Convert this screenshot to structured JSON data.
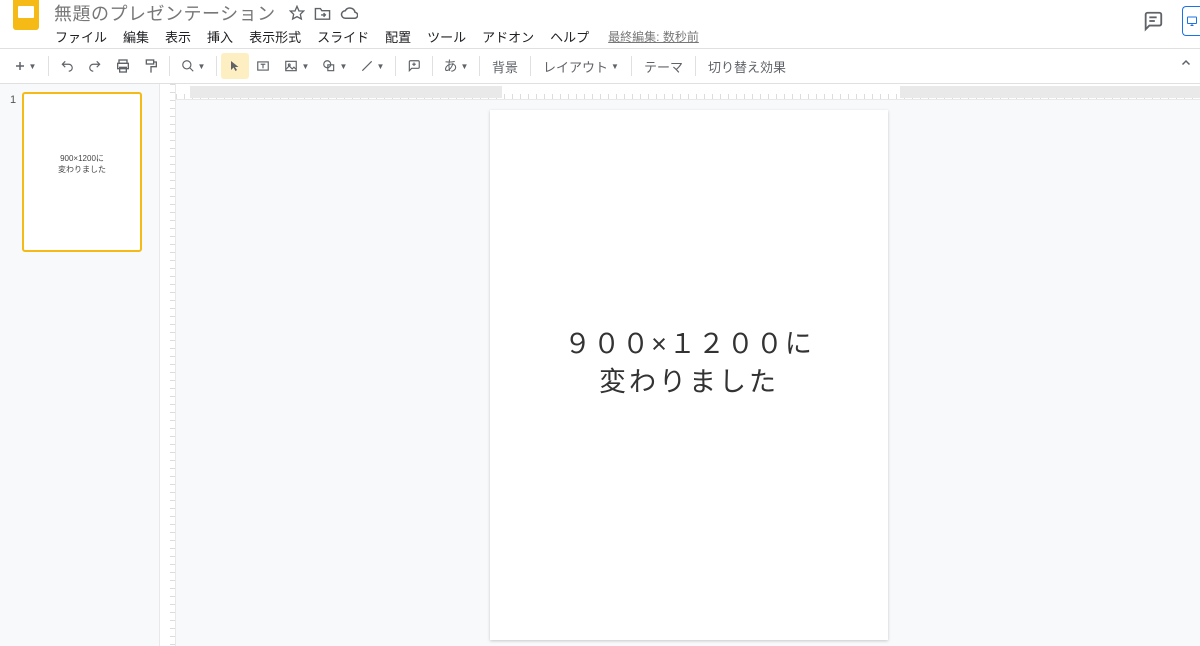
{
  "header": {
    "title": "無題のプレゼンテーション"
  },
  "menubar": {
    "items": [
      "ファイル",
      "編集",
      "表示",
      "挿入",
      "表示形式",
      "スライド",
      "配置",
      "ツール",
      "アドオン",
      "ヘルプ"
    ],
    "last_edit": "最終編集: 数秒前"
  },
  "toolbar": {
    "input_lang": "あ",
    "background": "背景",
    "layout": "レイアウト",
    "theme": "テーマ",
    "transition": "切り替え効果"
  },
  "thumbnail": {
    "number": "1",
    "line1": "900×1200に",
    "line2": "変わりました"
  },
  "slide": {
    "line1": "９００×１２００に",
    "line2": "変わりました"
  }
}
